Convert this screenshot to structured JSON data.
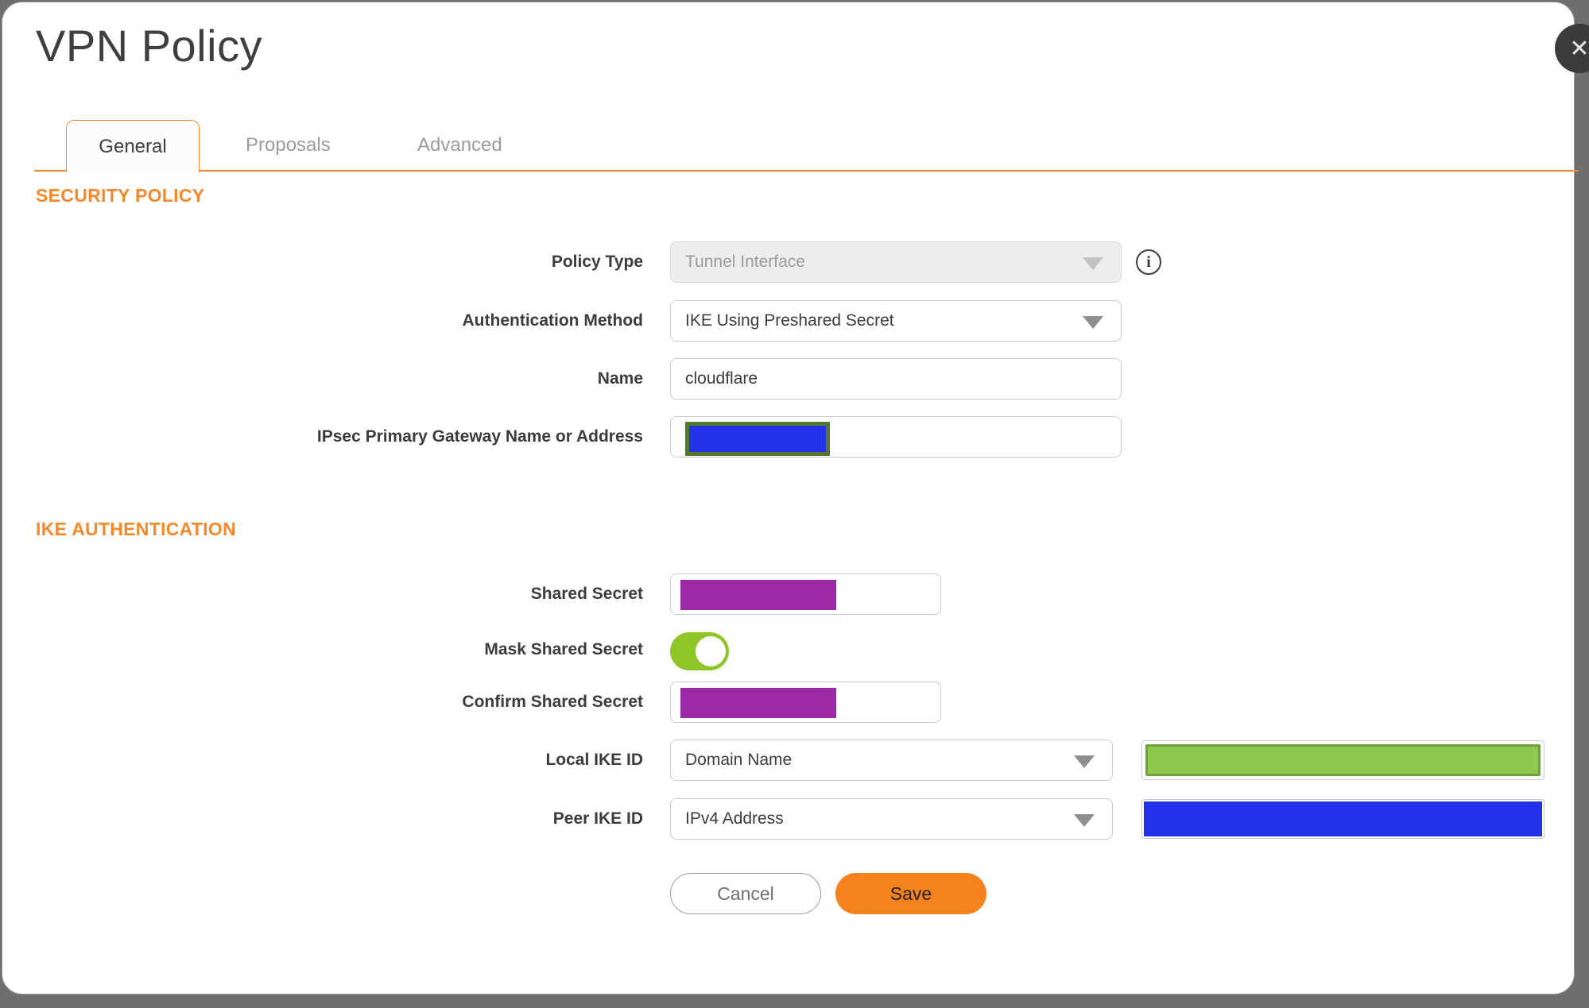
{
  "window": {
    "title": "VPN Policy",
    "close_icon": "✕"
  },
  "tabs": [
    {
      "label": "General",
      "active": true
    },
    {
      "label": "Proposals",
      "active": false
    },
    {
      "label": "Advanced",
      "active": false
    }
  ],
  "security_policy": {
    "heading": "SECURITY POLICY",
    "policy_type": {
      "label": "Policy Type",
      "value": "Tunnel Interface",
      "disabled": true
    },
    "authentication_method": {
      "label": "Authentication Method",
      "value": "IKE Using Preshared Secret"
    },
    "name": {
      "label": "Name",
      "value": "cloudflare"
    },
    "gateway": {
      "label": "IPsec Primary Gateway Name or Address",
      "value_redacted": true
    }
  },
  "ike_authentication": {
    "heading": "IKE AUTHENTICATION",
    "shared_secret": {
      "label": "Shared Secret",
      "value_redacted": true
    },
    "mask_shared_secret": {
      "label": "Mask Shared Secret",
      "state": "on"
    },
    "confirm_shared_secret": {
      "label": "Confirm Shared Secret",
      "value_redacted": true
    },
    "local_ike_id": {
      "label": "Local IKE ID",
      "value": "Domain Name",
      "id_value_redacted": true
    },
    "peer_ike_id": {
      "label": "Peer IKE ID",
      "value": "IPv4 Address",
      "id_value_redacted": true
    }
  },
  "buttons": {
    "cancel": "Cancel",
    "save": "Save"
  },
  "icons": [
    "close-icon",
    "info-icon",
    "dropdown-arrow-icon"
  ],
  "colors": {
    "accent_orange": "#F6882A",
    "save_orange": "#F6821E",
    "redact_purple": "#9B28A4",
    "redact_blue": "#2233E9",
    "redact_green": "#8EC84F",
    "redact_green_border": "#6FA238",
    "redact_olive_border": "#54782D",
    "toggle_green": "#8FC627",
    "backdrop_gray": "#6E6E6E"
  }
}
